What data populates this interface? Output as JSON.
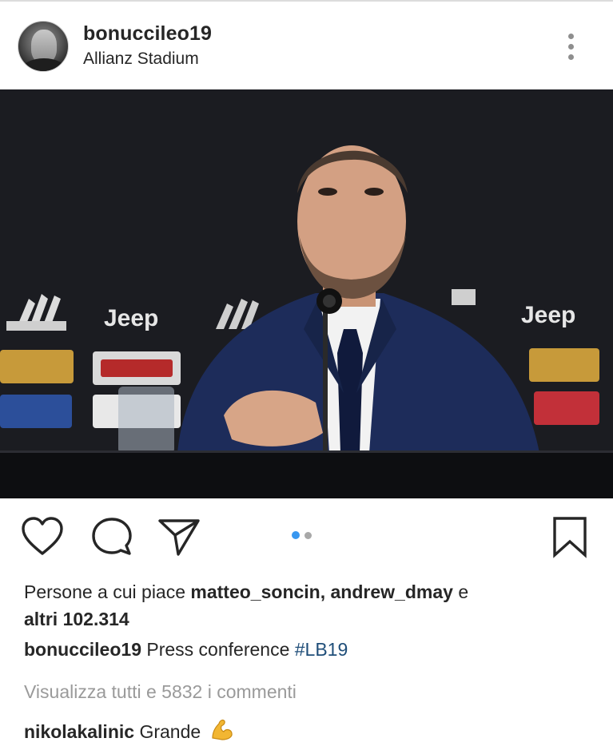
{
  "post": {
    "username": "bonuccileo19",
    "location": "Allianz Stadium"
  },
  "icons": {
    "more": "more-vertical-icon",
    "like": "heart-icon",
    "comment": "comment-bubble-icon",
    "share": "paper-plane-icon",
    "save": "bookmark-icon"
  },
  "carousel": {
    "total": 2,
    "active": 1
  },
  "photo_text": {
    "sponsor_1": "Jeep",
    "sponsor_2": "Jeep"
  },
  "likes": {
    "prefix": "Persone a cui piace",
    "user1": "matteo_soncin,",
    "user2": "andrew_dmay",
    "conj": "e",
    "others": "altri 102.314"
  },
  "caption": {
    "username": "bonuccileo19",
    "text": "Press conference",
    "hashtag": "#LB19"
  },
  "view_all_comments": "Visualizza tutti e 5832 i commenti",
  "comment": {
    "username": "nikolakalinic",
    "text": "Grande",
    "emoji": "flexed-biceps-emoji"
  },
  "colors": {
    "text": "#262626",
    "muted": "#9a9a9a",
    "hashtag": "#1f4e79",
    "active_dot": "#3897f0",
    "inactive_dot": "#a8a8a8"
  }
}
